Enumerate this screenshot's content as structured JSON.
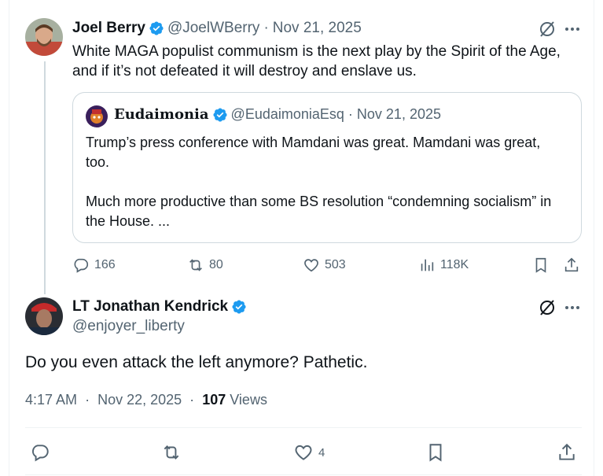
{
  "post": {
    "author": {
      "name": "Joel Berry",
      "handle": "@JoelWBerry",
      "date": "Nov 21, 2025"
    },
    "text": "White MAGA populist communism is the next play by the Spirit of the Age, and if it’s not defeated it will destroy and enslave us.",
    "quote": {
      "name": "Eudaimonia",
      "handle": "@EudaimoniaEsq",
      "date": "Nov 21, 2025",
      "paragraph1": "Trump’s press conference with Mamdani was great. Mamdani was great, too.",
      "paragraph2": "Much more productive than some BS resolution “condemning socialism” in the House. ..."
    },
    "stats": {
      "replies": "166",
      "reposts": "80",
      "likes": "503",
      "views": "118K"
    }
  },
  "reply": {
    "author": {
      "name": "LT Jonathan Kendrick",
      "handle": "@enjoyer_liberty"
    },
    "text": "Do you even attack the left anymore? Pathetic.",
    "time": "4:17 AM",
    "date": "Nov 22, 2025",
    "views_count": "107",
    "views_label": "Views",
    "stats": {
      "likes": "4"
    }
  },
  "colors": {
    "verified": "#1d9bf0",
    "text": "#0f1419",
    "muted": "#536471",
    "border": "#cfd9de"
  }
}
